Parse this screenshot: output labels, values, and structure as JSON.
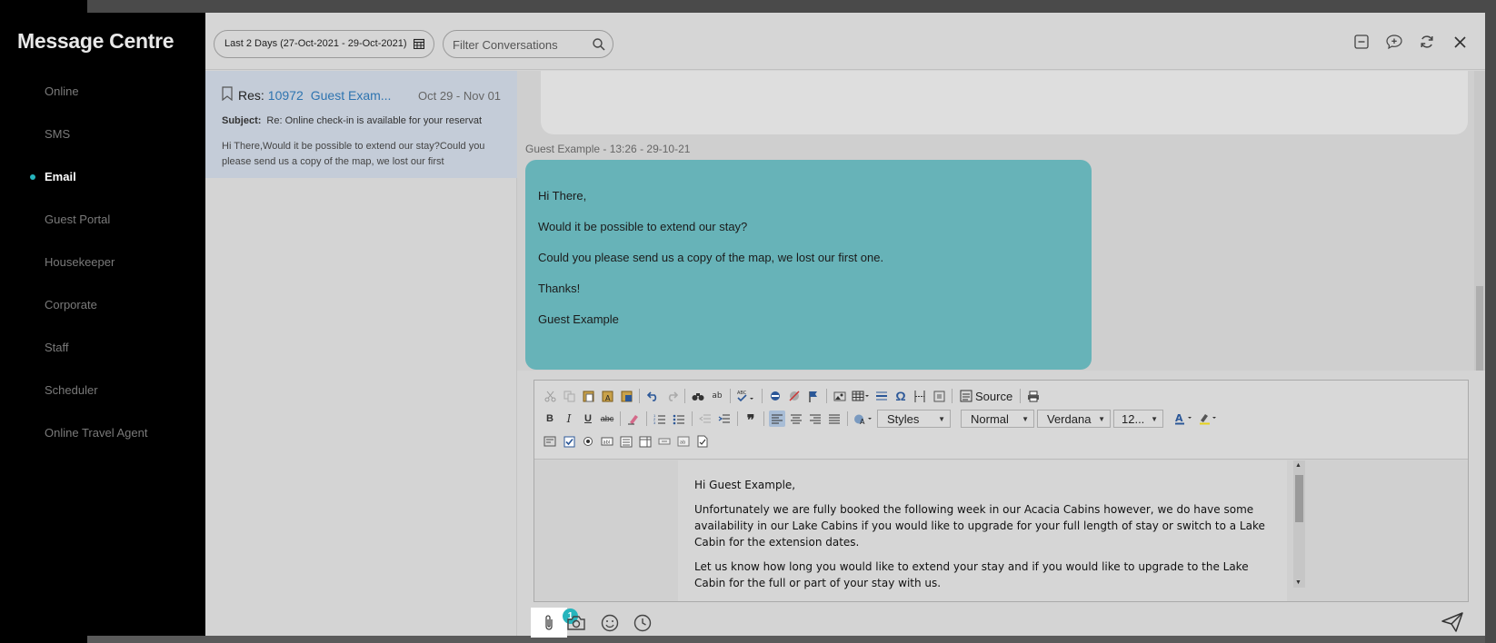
{
  "app": {
    "title": "Message Centre"
  },
  "sidebar": {
    "items": [
      {
        "label": "Online",
        "active": false
      },
      {
        "label": "SMS",
        "active": false
      },
      {
        "label": "Email",
        "active": true
      },
      {
        "label": "Guest Portal",
        "active": false
      },
      {
        "label": "Housekeeper",
        "active": false
      },
      {
        "label": "Corporate",
        "active": false
      },
      {
        "label": "Staff",
        "active": false
      },
      {
        "label": "Scheduler",
        "active": false
      },
      {
        "label": "Online Travel Agent",
        "active": false
      }
    ]
  },
  "topbar": {
    "date_filter": "Last 2 Days (27-Oct-2021 - 29-Oct-2021)",
    "search_placeholder": "Filter Conversations"
  },
  "conversations": [
    {
      "prefix": "Res:",
      "res_number": "10972",
      "guest": "Guest Exam...",
      "dates": "Oct 29 - Nov 01",
      "subject_label": "Subject:",
      "subject": "Re: Online check-in is available for your reservat",
      "preview": "Hi There,Would it be possible to extend our stay?Could you please send us a copy of the map, we lost our first"
    }
  ],
  "thread": {
    "sender_line": "Guest Example - 13:26 - 29-10-21",
    "message": [
      "Hi There,",
      "Would it be possible to extend our stay?",
      "Could you please send us a copy of the map, we lost our first one.",
      "Thanks!",
      "Guest Example"
    ]
  },
  "editor": {
    "source_label": "Source",
    "styles": "Styles",
    "format": "Normal",
    "font": "Verdana",
    "size": "12...",
    "body": [
      "Hi Guest Example,",
      "Unfortunately we are fully booked the following week in our Acacia Cabins however, we do have some availability in our Lake Cabins if you would like to upgrade for your full length of stay or switch to a Lake Cabin for the extension dates.",
      "Let us know how long you would like to extend your stay and if you would like to upgrade to the Lake Cabin for the full or part of your stay with us."
    ]
  },
  "composer": {
    "attachment_count": "1"
  },
  "colors": {
    "accent": "#26b5bd",
    "bubble": "#67b3b8",
    "link": "#2e74b0"
  }
}
